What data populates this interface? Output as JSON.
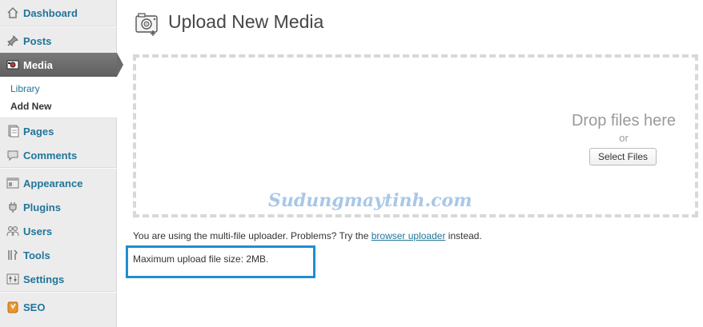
{
  "sidebar": {
    "items": [
      {
        "key": "dashboard",
        "label": "Dashboard",
        "icon": "dashboard-icon"
      },
      {
        "key": "posts",
        "label": "Posts",
        "icon": "pushpin-icon"
      },
      {
        "key": "media",
        "label": "Media",
        "icon": "media-icon",
        "current": true
      },
      {
        "key": "pages",
        "label": "Pages",
        "icon": "pages-icon"
      },
      {
        "key": "comments",
        "label": "Comments",
        "icon": "speech-bubble-icon"
      },
      {
        "key": "appearance",
        "label": "Appearance",
        "icon": "appearance-icon"
      },
      {
        "key": "plugins",
        "label": "Plugins",
        "icon": "plug-icon"
      },
      {
        "key": "users",
        "label": "Users",
        "icon": "users-icon"
      },
      {
        "key": "tools",
        "label": "Tools",
        "icon": "tools-icon"
      },
      {
        "key": "settings",
        "label": "Settings",
        "icon": "settings-icon"
      },
      {
        "key": "seo",
        "label": "SEO",
        "icon": "seo-icon"
      }
    ],
    "media_submenu": [
      {
        "label": "Library"
      },
      {
        "label": "Add New",
        "active": true
      }
    ]
  },
  "main": {
    "title": "Upload New Media",
    "drop_text": "Drop files here",
    "or_text": "or",
    "select_button": "Select Files",
    "uploader_text_before": "You are using the multi-file uploader. Problems? Try the ",
    "uploader_link": "browser uploader",
    "uploader_text_after": " instead.",
    "max_upload": "Maximum upload file size: 2MB."
  },
  "watermark": "Sudungmaytinh.com",
  "colors": {
    "link": "#21759b",
    "highlight_border": "#1e8fd0",
    "current_menu_bg": "#6a6a6a",
    "sidebar_bg": "#ececec"
  }
}
